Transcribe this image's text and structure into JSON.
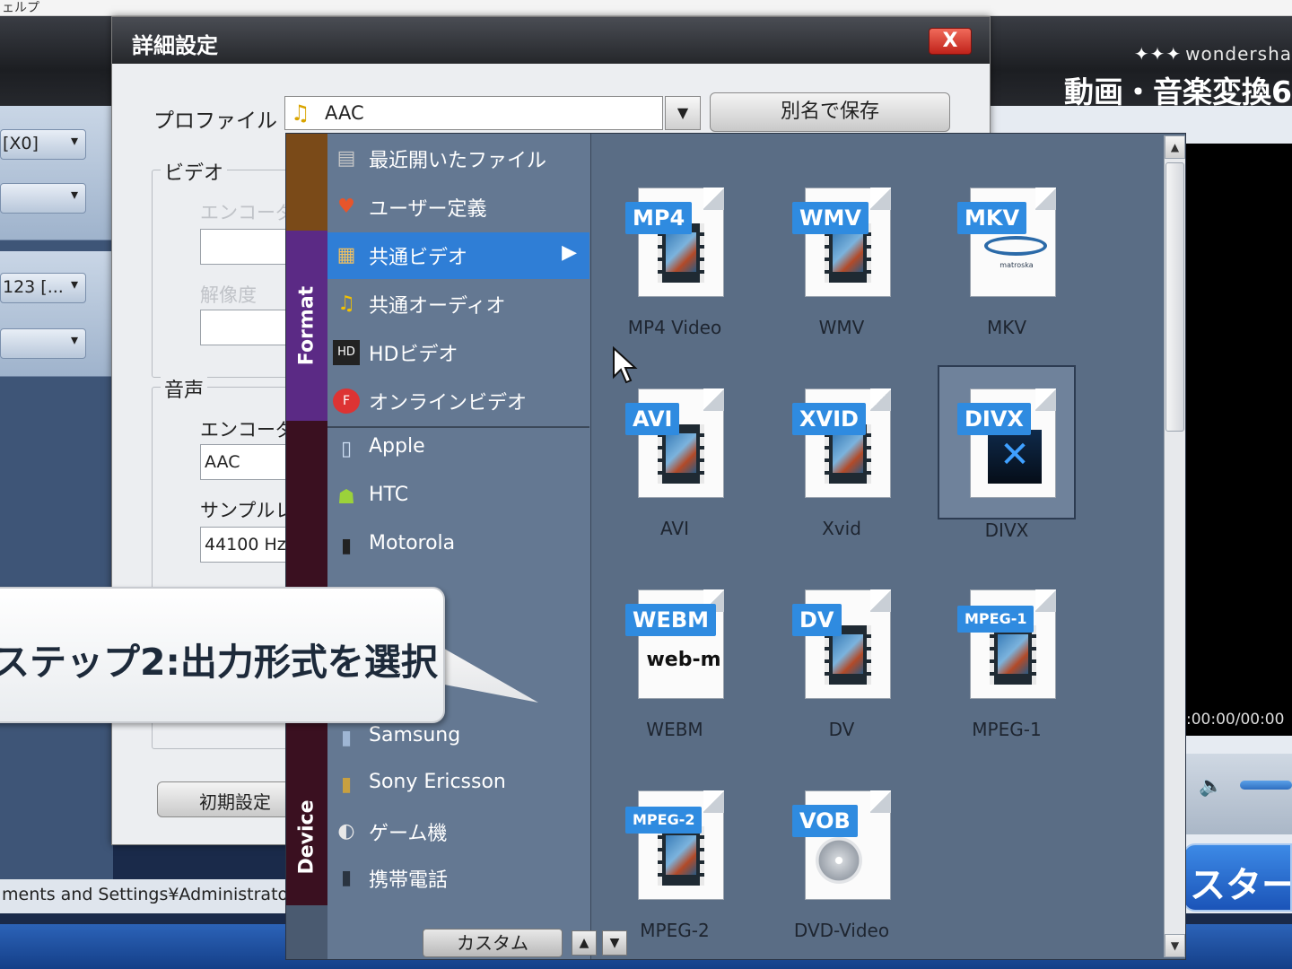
{
  "app": {
    "top_text": "ェルプ",
    "brand_logo": "wondersha",
    "brand_title": "動画・音楽変換6",
    "left_fields": [
      "[X0]",
      "",
      "123 [...",
      ""
    ],
    "timecode": ":00:00/00:00",
    "start_label": "スタート",
    "path_text": "ments and Settings¥Administrator"
  },
  "dialog": {
    "title": "詳細設定",
    "close_label": "X",
    "profile_label": "プロファイル",
    "profile_value": "AAC",
    "save_as_label": "別名で保存",
    "video_group": "ビデオ",
    "encoder_label": "エンコーダ",
    "resolution_label": "解像度",
    "audio_group": "音声",
    "audio_encoder_label": "エンコーダ",
    "audio_encoder_value": "AAC",
    "sample_rate_label": "サンプルレ",
    "sample_rate_value": "44100 Hz",
    "default_button": "初期設定"
  },
  "popup": {
    "tabs": [
      "Format",
      "Device"
    ],
    "categories": [
      {
        "label": "最近開いたファイル",
        "icon": "folder-icon",
        "selected": false
      },
      {
        "label": "ユーザー定義",
        "icon": "heart-icon",
        "selected": false
      },
      {
        "label": "共通ビデオ",
        "icon": "video-icon",
        "selected": true
      },
      {
        "label": "共通オーディオ",
        "icon": "music-icon",
        "selected": false
      },
      {
        "label": "HDビデオ",
        "icon": "hd-icon",
        "selected": false
      },
      {
        "label": "オンラインビデオ",
        "icon": "online-icon",
        "selected": false
      },
      {
        "label": "Apple",
        "icon": "apple-icon",
        "selected": false
      },
      {
        "label": "HTC",
        "icon": "android-icon",
        "selected": false
      },
      {
        "label": "Motorola",
        "icon": "phone-icon",
        "selected": false
      },
      {
        "label": "Samsung",
        "icon": "phone-icon",
        "selected": false
      },
      {
        "label": "Sony Ericsson",
        "icon": "phone-icon",
        "selected": false
      },
      {
        "label": "ゲーム機",
        "icon": "game-icon",
        "selected": false
      },
      {
        "label": "携帯電話",
        "icon": "mobile-icon",
        "selected": false
      }
    ],
    "custom_label": "カスタム",
    "formats": [
      {
        "badge": "MP4",
        "label": "MP4 Video"
      },
      {
        "badge": "WMV",
        "label": "WMV"
      },
      {
        "badge": "MKV",
        "label": "MKV"
      },
      {
        "badge": "AVI",
        "label": "AVI"
      },
      {
        "badge": "XVID",
        "label": "Xvid"
      },
      {
        "badge": "DIVX",
        "label": "DIVX"
      },
      {
        "badge": "WEBM",
        "label": "WEBM"
      },
      {
        "badge": "DV",
        "label": "DV"
      },
      {
        "badge": "MPEG-1",
        "label": "MPEG-1"
      },
      {
        "badge": "MPEG-2",
        "label": "MPEG-2"
      },
      {
        "badge": "VOB",
        "label": "DVD-Video"
      }
    ],
    "webm_text": "web-m",
    "mkv_text": "matroska"
  },
  "callout": {
    "text": "ステップ2:出力形式を選択"
  }
}
